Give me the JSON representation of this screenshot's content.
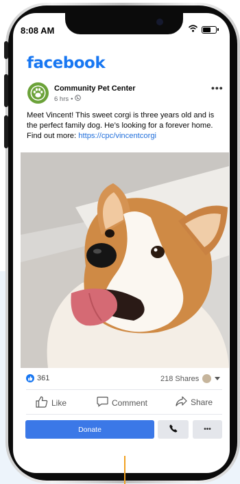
{
  "status_bar": {
    "time": "8:08 AM"
  },
  "app": {
    "logo": "facebook",
    "brand_color": "#1877f2"
  },
  "post": {
    "author": "Community Pet Center",
    "time_ago": "6 hrs",
    "audience_icon": "globe-icon",
    "text": "Meet Vincent! This sweet corgi is three years old and is the perfect family dog. He’s looking for a forever home. Find out more: ",
    "link": "https://cpc/vincentcorgi",
    "photo": "corgi-dog-photo",
    "reaction_count": "361",
    "shares": "218 Shares"
  },
  "actions": {
    "like": "Like",
    "comment": "Comment",
    "share": "Share"
  },
  "cta": {
    "donate": "Donate",
    "accent": "#3b78e7"
  }
}
